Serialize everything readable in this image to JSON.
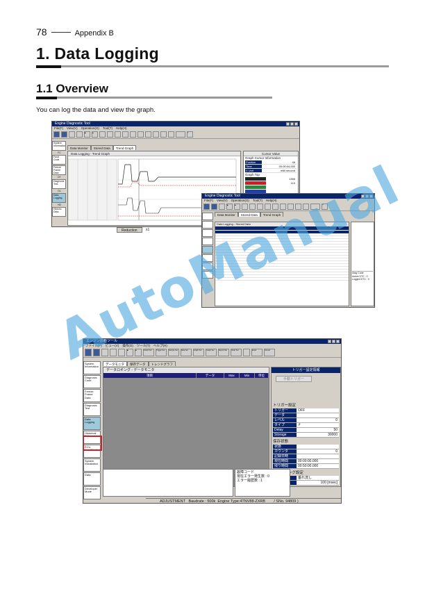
{
  "page": {
    "number": "78",
    "section": "Appendix B",
    "title": "1. Data Logging",
    "subtitle": "1.1 Overview",
    "intro": "You can log the data and view the graph.",
    "watermark": "AutoManual"
  },
  "colors": {
    "title_bar": "#0a246a",
    "window_bg": "#d4d0c8",
    "highlight": "#c8202c",
    "watermark": "#50aae1"
  },
  "win1": {
    "title": "Engine Diagnostic Tool",
    "menu": [
      "File(F)",
      "View(V)",
      "Operation(O)",
      "Tool(T)",
      "Help(H)"
    ],
    "tabs": [
      "Data Monitor",
      "Stored Data",
      "Trend Graph"
    ],
    "side": [
      {
        "label": "System Information",
        "group": ""
      },
      {
        "label": "Fault Code",
        "group": "FC"
      },
      {
        "label": "Freeze Frame Data",
        "group": ""
      },
      {
        "label": "Diagnosis Test",
        "group": "DT"
      },
      {
        "label": "Data Logging",
        "group": "DL"
      },
      {
        "label": "Historic Data",
        "group": "HD"
      },
      {
        "label": "ECU Identification",
        "group": "EIDA"
      },
      {
        "label": "System Installation",
        "group": "SYSI"
      },
      {
        "label": "Data",
        "group": "DATA"
      },
      {
        "label": "Develop Mode",
        "group": "DMODE"
      }
    ],
    "panel_title": "Data Logging - Trend Graph",
    "cursor_title": "Cursor Value",
    "cursor_info": "Graph Cursor Information",
    "cursor_rows": [
      {
        "k": "Position",
        "v": "46"
      },
      {
        "k": "Time",
        "v": "00:00:04,000"
      },
      {
        "k": "X Unit",
        "v": "milli second"
      }
    ],
    "graph_top": "Graph Top",
    "graph_values": [
      {
        "color": "#222222",
        "v": "1356"
      },
      {
        "color": "#c8202c",
        "v": "110"
      },
      {
        "color": "#2a8a3a",
        "v": ""
      },
      {
        "color": "#2040b0",
        "v": ""
      }
    ],
    "reduction": "Reduction",
    "reduction_value": "x1"
  },
  "win2": {
    "title": "Engine Diagnostic Tool",
    "menu": [
      "File(F)",
      "View(V)",
      "Operation(O)",
      "Tool(T)",
      "Help(H)"
    ],
    "tabs": [
      "Data Monitor",
      "Stored Data",
      "Trend Graph"
    ],
    "panel_title": "Data Logging - Stored Data",
    "info": [
      "Diag Code",
      "Active DTC : 0",
      "Logged DTC : 0"
    ]
  },
  "win3": {
    "title": "エンジン診断ツール",
    "menu": [
      "ファイル(F)",
      "ビュー(V)",
      "操作(O)",
      "ツール(T)",
      "ヘルプ(H)"
    ],
    "toolbar_labels": [
      "Clutch Sel",
      "Trigger Set",
      "Sample Set",
      "Data Sel",
      "Graph Set",
      "Graph Sel",
      "Report Set",
      "Chart Set",
      "Excel",
      "Unexel"
    ],
    "tabs": [
      "データモニタ",
      "保存データ",
      "トレンドグラフ"
    ],
    "side": [
      "System Information",
      "Diagnosis Code",
      "Freeze Frame Data",
      "Diagnosis Test",
      "Data Logging",
      "Historical Data",
      "ECU Identification",
      "System Installation",
      "Data",
      "Developer Mode"
    ],
    "monitor_title": "データロギング - データモニタ",
    "columns": [
      "項目",
      "データ",
      "Max",
      "Min",
      "単位"
    ],
    "trigger_title": "トリガー設定情報",
    "trigger_button": "手動トリガー",
    "trigger_section": "トリガー設定",
    "trigger_rows": [
      {
        "k": "トリガー",
        "v": "OFF"
      },
      {
        "k": "データ",
        "v": ""
      },
      {
        "k": "レベル",
        "v": "0"
      },
      {
        "k": "タイプ",
        "v": "↱"
      },
      {
        "k": "Delay",
        "v": "50"
      },
      {
        "k": "Storage",
        "v": "30000"
      }
    ],
    "save_section": "保存状態",
    "save_rows": [
      {
        "k": "状態",
        "v": ""
      },
      {
        "k": "カウンタ",
        "v": "0"
      },
      {
        "k": "記録日時",
        "v": ""
      },
      {
        "k": "現在時間",
        "v": "00:00:00.000"
      },
      {
        "k": "残り時間",
        "v": "00:50:00.000"
      }
    ],
    "sampling_section": "サンプリング設定",
    "sampling_rows": [
      {
        "k": "モード",
        "v": "垂れ流し"
      },
      {
        "k": "間隔",
        "v": "100 [msec]"
      }
    ],
    "fault": [
      "故障コード",
      "現在エラー発生数 : 0",
      "エラー履歴数 : 1"
    ],
    "status": "ADJUSTMENT   Baudrate : 500k  Engine Type:4TNV88-ZXRB        / SNo. 94809 )"
  }
}
